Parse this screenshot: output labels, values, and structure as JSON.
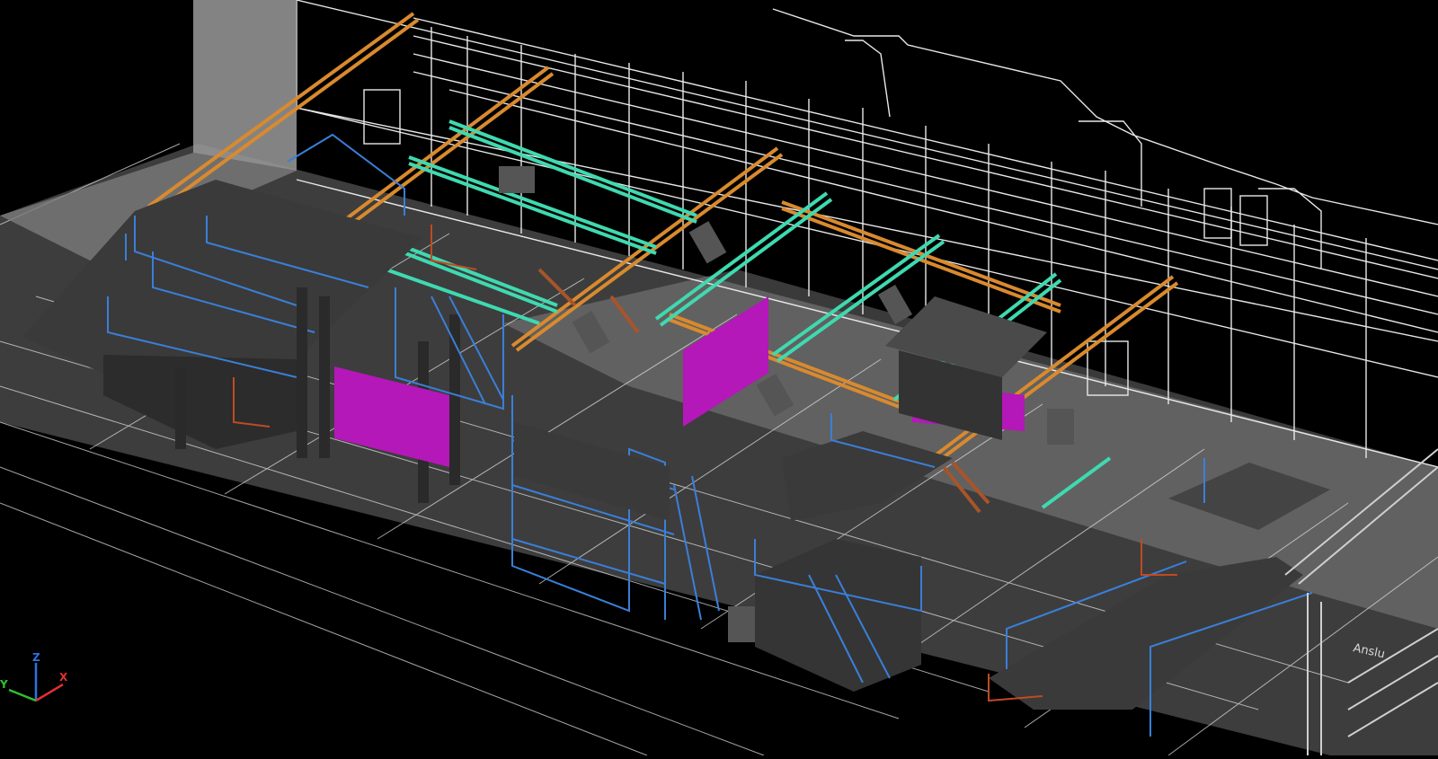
{
  "viewport": {
    "background": "#000000"
  },
  "colors": {
    "truss_orange": "#d98a2e",
    "truss_green": "#3fd9b0",
    "railing_blue": "#3a7fd8",
    "railing_red": "#c04a22",
    "screen_magenta": "#b418b8",
    "platform_gray": "#3c3c3c",
    "floor_gray": "#8f8f8f",
    "wireframe_white": "#e8e8e8",
    "stair_brown": "#a8542a"
  },
  "drawing": {
    "side_label": "Anslu"
  },
  "ucs_icon": {
    "x_label": "X",
    "y_label": "Y",
    "z_label": "Z",
    "x_color": "#e03030",
    "y_color": "#30c030",
    "z_color": "#3070e0"
  }
}
